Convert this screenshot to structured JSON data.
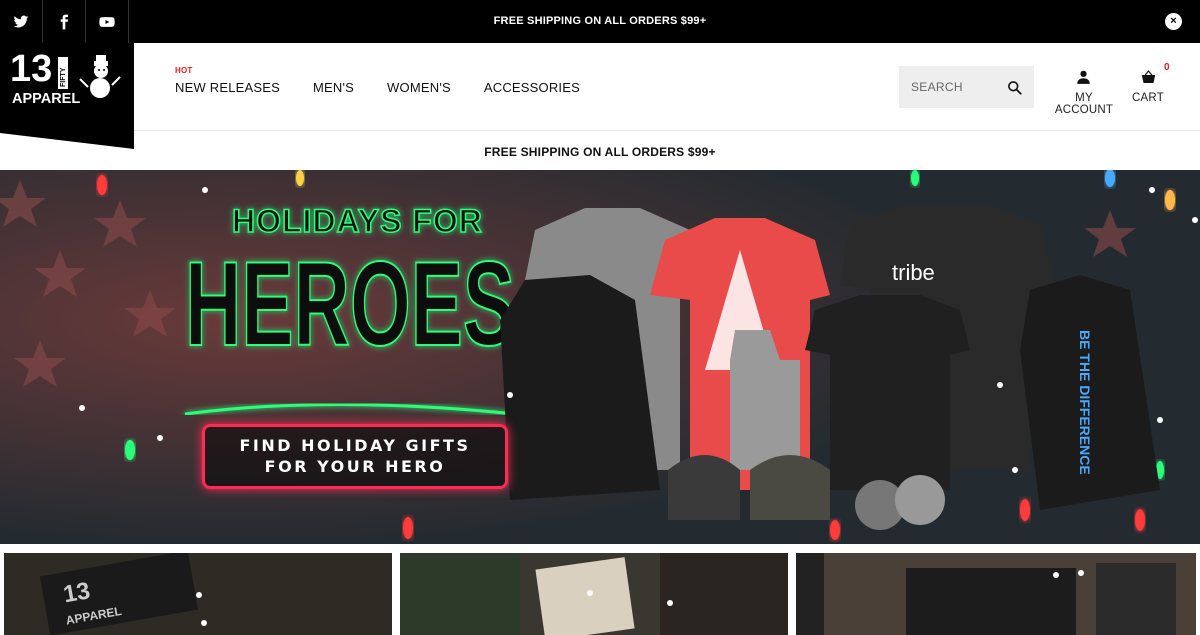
{
  "topbar": {
    "message": "FREE SHIPPING ON ALL ORDERS $99+",
    "social": [
      "twitter-icon",
      "facebook-icon",
      "youtube-icon"
    ],
    "close_label": "×"
  },
  "logo": {
    "brand_number": "13",
    "brand_sub": "FIFTY",
    "brand_word": "APPAREL"
  },
  "nav": {
    "hot_badge": "HOT",
    "items": [
      "NEW RELEASES",
      "MEN'S",
      "WOMEN'S",
      "ACCESSORIES"
    ]
  },
  "search": {
    "placeholder": "SEARCH"
  },
  "account": {
    "label": "MY ACCOUNT"
  },
  "cart": {
    "label": "CART",
    "count": "0"
  },
  "shipping_banner": {
    "text": "FREE SHIPPING ON ALL ORDERS $99+"
  },
  "hero": {
    "headline_small": "HOLIDAYS FOR",
    "headline_big": "HEROES",
    "cta_line1": "FIND HOLIDAY GIFTS",
    "cta_line2": "FOR YOUR HERO",
    "shirt_brand": "tribe",
    "hoodie_text": "BE THE DIFFERENCE",
    "accent_green": "#2bff7a",
    "accent_red": "#ff2b55",
    "shirt_red": "#e94a4a"
  },
  "colors": {
    "topbar_bg": "#000000",
    "hot": "#e02020",
    "text": "#111111"
  }
}
